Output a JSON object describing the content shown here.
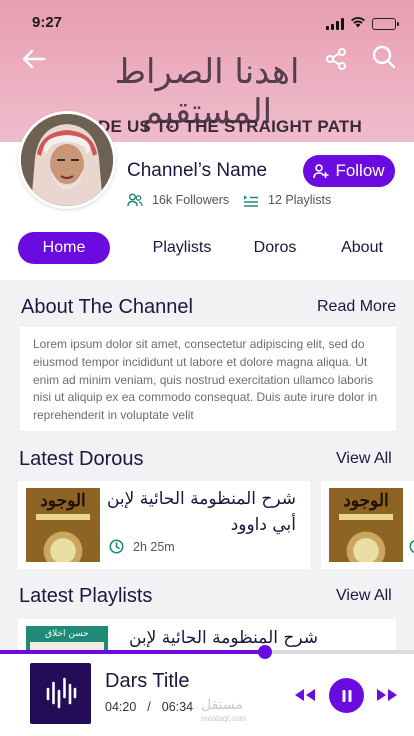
{
  "status_bar": {
    "time": "9:27"
  },
  "banner": {
    "arabic_text": "اهدنا الصراط المستقيم",
    "english_text": "DE US TO THE STRAIGHT PATH"
  },
  "channel": {
    "name": "Channel’s Name",
    "follow_label": "Follow",
    "followers": "16k Followers",
    "playlists": "12 Playlists"
  },
  "tabs": [
    {
      "label": "Home",
      "active": true
    },
    {
      "label": "Playlists",
      "active": false
    },
    {
      "label": "Doros",
      "active": false
    },
    {
      "label": "About",
      "active": false
    }
  ],
  "about": {
    "title": "About The Channel",
    "read_more": "Read More",
    "text": "Lorem ipsum dolor sit amet, consectetur adipiscing elit, sed do eiusmod tempor incididunt ut labore et dolore magna aliqua. Ut enim ad minim veniam, quis nostrud exercitation ullamco laboris nisi ut aliquip ex ea commodo consequat. Duis aute irure dolor in reprehenderit in voluptate velit"
  },
  "latest_dorous": {
    "title": "Latest Dorous",
    "view_all": "View All",
    "items": [
      {
        "title": "شرح المنظومة الحائية لإبن أبي داوود",
        "duration": "2h 25m",
        "cover_text": "الوجود"
      },
      {
        "title": "",
        "duration": "",
        "cover_text": "الوجود"
      }
    ]
  },
  "latest_playlists": {
    "title": "Latest Playlists",
    "view_all": "View All",
    "items": [
      {
        "title": "شرح المنظومة الحائية لإبن",
        "thumb_text": "حسن اخلاق"
      }
    ]
  },
  "player": {
    "title": "Dars Title",
    "current_time": "04:20",
    "separator": "/",
    "total_time": "06:34",
    "progress": 0.64,
    "watermark": "مستقل",
    "watermark_sub": "mostaql.com"
  },
  "colors": {
    "accent": "#6a0ce0",
    "teal": "#1f8a77",
    "text": "#1e1540",
    "banner": "#ecb0c1"
  },
  "icons": [
    "back-arrow-icon",
    "share-icon",
    "search-icon",
    "add-user-icon",
    "followers-icon",
    "playlist-icon",
    "clock-icon",
    "rewind-icon",
    "pause-icon",
    "fast-forward-icon",
    "audio-wave-icon"
  ]
}
